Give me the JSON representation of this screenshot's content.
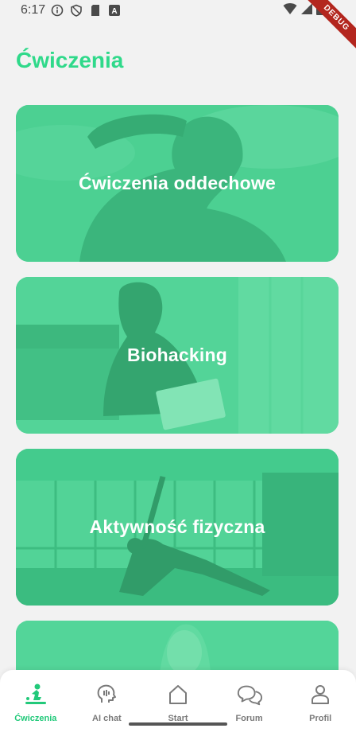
{
  "status_bar": {
    "time": "6:17",
    "icons": [
      "info-icon",
      "shield-icon",
      "sd-card-icon",
      "font-icon",
      "wifi-icon",
      "signal-icon",
      "battery-icon"
    ],
    "debug_banner": "DEBUG"
  },
  "header": {
    "title": "Ćwiczenia"
  },
  "cards": [
    {
      "label": "Ćwiczenia oddechowe"
    },
    {
      "label": "Biohacking"
    },
    {
      "label": "Aktywność fizyczna"
    },
    {
      "label": ""
    }
  ],
  "bottom_nav": {
    "items": [
      {
        "label": "Ćwiczenia",
        "icon": "exercise-icon",
        "active": true
      },
      {
        "label": "AI chat",
        "icon": "ai-head-icon",
        "active": false
      },
      {
        "label": "Start",
        "icon": "home-icon",
        "active": false
      },
      {
        "label": "Forum",
        "icon": "chat-bubbles-icon",
        "active": false
      },
      {
        "label": "Profil",
        "icon": "person-icon",
        "active": false
      }
    ]
  },
  "colors": {
    "accent": "#22c97a",
    "card_overlay": "#3dd68c",
    "background": "#f2f2f2"
  }
}
